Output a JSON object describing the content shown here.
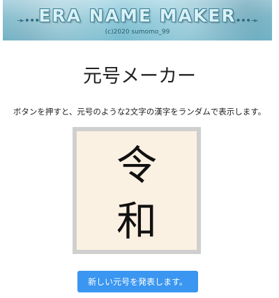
{
  "banner": {
    "title": "ERA NAME MAKER",
    "credit": "(c)2020 sumomo_99",
    "left_arrow": "➛•••",
    "right_arrow": "•••➛"
  },
  "heading": "元号メーカー",
  "description": "ボタンを押すと、元号のような2文字の漢字をランダムで表示します。",
  "era_name": {
    "first_char": "令",
    "second_char": "和"
  },
  "button": {
    "label": "新しい元号を発表します。"
  },
  "colors": {
    "button_bg": "#3a96f0",
    "card_bg": "#fbf1e2",
    "card_border": "#cfcfcf",
    "banner_bg": "#8ec8d8"
  }
}
